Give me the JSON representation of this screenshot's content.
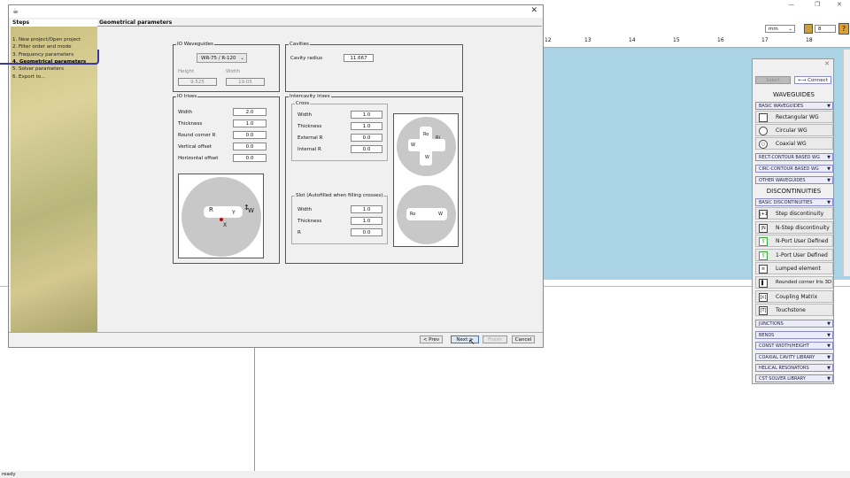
{
  "app": {
    "status": "ready",
    "units": "mm",
    "zoom_value": "8",
    "ruler": [
      "12",
      "13",
      "14",
      "15",
      "16",
      "17",
      "18"
    ]
  },
  "dialog": {
    "section_title": "Geometrical parameters",
    "steps_header": "Steps",
    "steps": [
      "1. New project/Open project",
      "2. Filter order and mode",
      "3. Frequency parameters",
      "4. Geometrical parameters",
      "5. Solver parameters",
      "6. Export to..."
    ],
    "io_waveguides": {
      "title": "IO Waveguides",
      "select": "WR-75 / R-120",
      "height_label": "Height",
      "width_label": "Width",
      "height": "9.525",
      "width": "19.05"
    },
    "cavities": {
      "title": "Cavities",
      "radius_label": "Cavity radius",
      "radius": "11.667"
    },
    "io_irises": {
      "title": "IO Irises",
      "rows": [
        {
          "label": "Width",
          "value": "2.0"
        },
        {
          "label": "Thickness",
          "value": "1.0"
        },
        {
          "label": "Round corner R",
          "value": "0.0"
        },
        {
          "label": "Vertical offset",
          "value": "0.0"
        },
        {
          "label": "Horizontal offset",
          "value": "0.0"
        }
      ],
      "fig": {
        "r": "R",
        "y": "Y",
        "w": "W",
        "x": "X"
      }
    },
    "intercavity": {
      "title": "Intercavity irises",
      "cross": {
        "title": "Cross",
        "rows": [
          {
            "label": "Width",
            "value": "1.0"
          },
          {
            "label": "Thickness",
            "value": "1.0"
          },
          {
            "label": "External R",
            "value": "0.0"
          },
          {
            "label": "Internal R",
            "value": "0.0"
          }
        ]
      },
      "slot": {
        "title": "Slot (Autofilled when filling crosses)",
        "rows": [
          {
            "label": "Width",
            "value": "1.0"
          },
          {
            "label": "Thickness",
            "value": "1.0"
          },
          {
            "label": "R",
            "value": "0.0"
          }
        ]
      },
      "fig": {
        "ro": "Ro",
        "ri": "Ri",
        "w": "W"
      }
    },
    "buttons": {
      "prev": "< Prev",
      "next": "Next >",
      "finish": "Finish",
      "cancel": "Cancel"
    }
  },
  "palette": {
    "select": "Select",
    "connect": "←→ Connect",
    "waveguides_header": "WAVEGUIDES",
    "basic_wg": "BASIC WAVEGUIDES",
    "wg_items": [
      {
        "label": "Rectangular WG",
        "icon": "rect-wg-icon"
      },
      {
        "label": "Circular WG",
        "icon": "circ-wg-icon"
      },
      {
        "label": "Coaxial WG",
        "icon": "coax-wg-icon"
      }
    ],
    "wg_groups": [
      "RECT-CONTOUR BASED WG",
      "CIRC-CONTOUR BASED WG",
      "OTHER WAVEGUIDES"
    ],
    "disc_header": "DISCONTINUITIES",
    "basic_disc": "BASIC DISCONTINUITIES",
    "disc_items": [
      {
        "label": "Step discontinuity",
        "icon": "step-disc-icon",
        "glyph": "|+1"
      },
      {
        "label": "N-Step discontinuity",
        "icon": "nstep-disc-icon",
        "glyph": "|N"
      },
      {
        "label": "N-Port User Defined",
        "icon": "nport-icon",
        "glyph": "§"
      },
      {
        "label": "1-Port User Defined",
        "icon": "oneport-icon",
        "glyph": "§"
      },
      {
        "label": "Lumped element",
        "icon": "lumped-icon",
        "glyph": "≡"
      },
      {
        "label": "Rounded corner Iris 3D",
        "icon": "iris3d-icon",
        "glyph": "▌"
      },
      {
        "label": "Coupling Matrix",
        "icon": "coupling-icon",
        "glyph": "[c]"
      },
      {
        "label": "Touchstone",
        "icon": "touchstone-icon",
        "glyph": "[T]"
      }
    ],
    "groups": [
      "JUNCTIONS",
      "BENDS",
      "CONST WIDTH/HEIGHT",
      "COAXIAL CAVITY LIBRARY",
      "HELICAL RESONATORS",
      "CST SOLVER LIBRARY"
    ]
  }
}
